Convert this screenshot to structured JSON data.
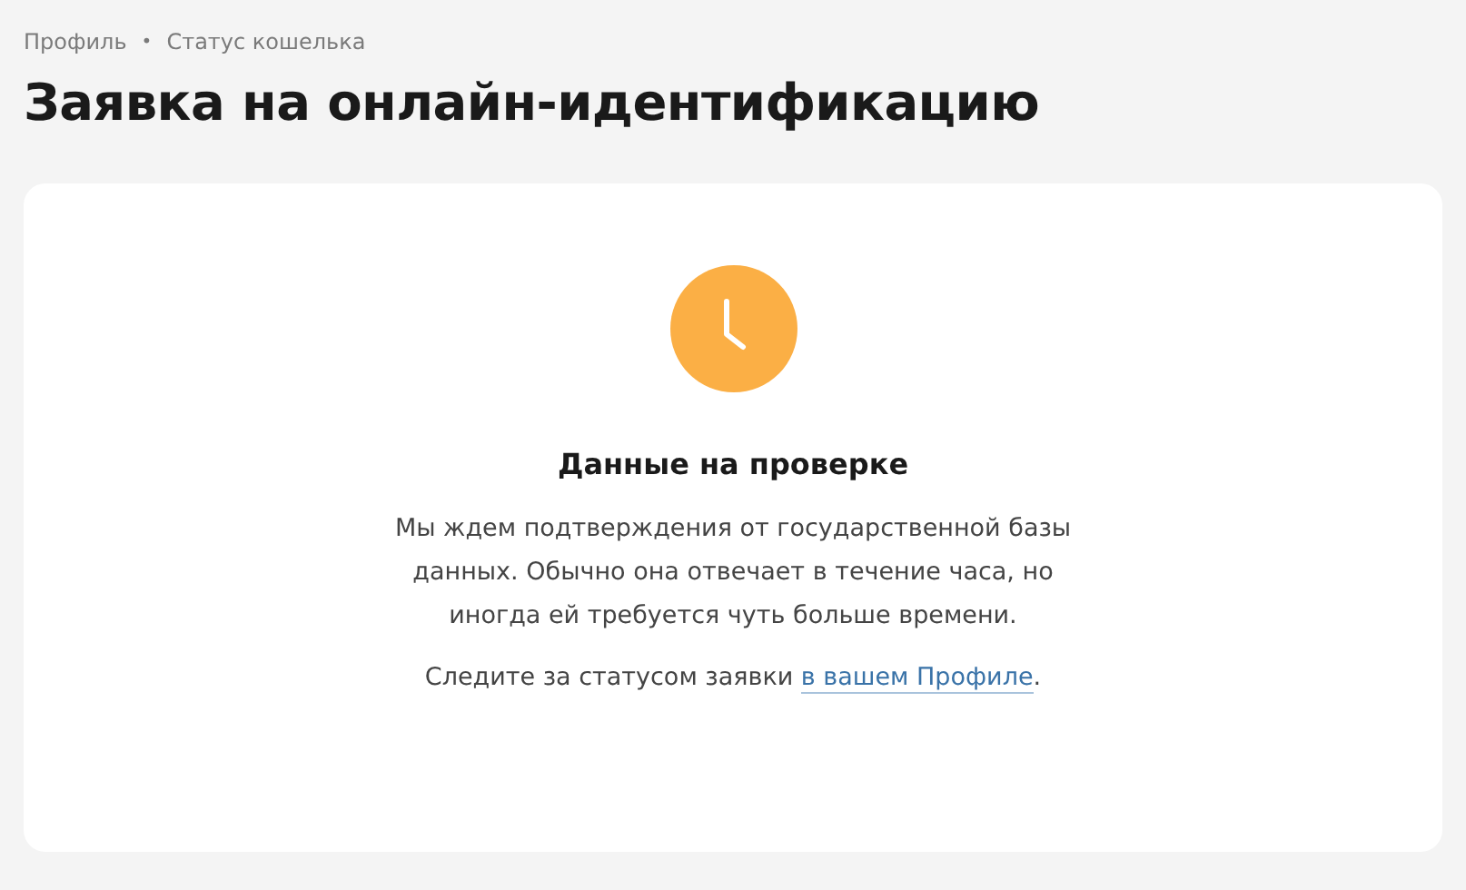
{
  "breadcrumbs": {
    "items": [
      "Профиль",
      "Статус кошелька"
    ],
    "separator": "•"
  },
  "title": "Заявка на онлайн-идентификацию",
  "status": {
    "kind": "pending",
    "heading": "Данные на проверке",
    "message": "Мы ждем подтверждения от государственной базы данных. Обычно она отвечает в течение часа, но иногда ей требуется чуть больше времени.",
    "hint": {
      "before": "Следите за статусом заявки ",
      "link": "в вашем Профиле",
      "after": "."
    }
  }
}
